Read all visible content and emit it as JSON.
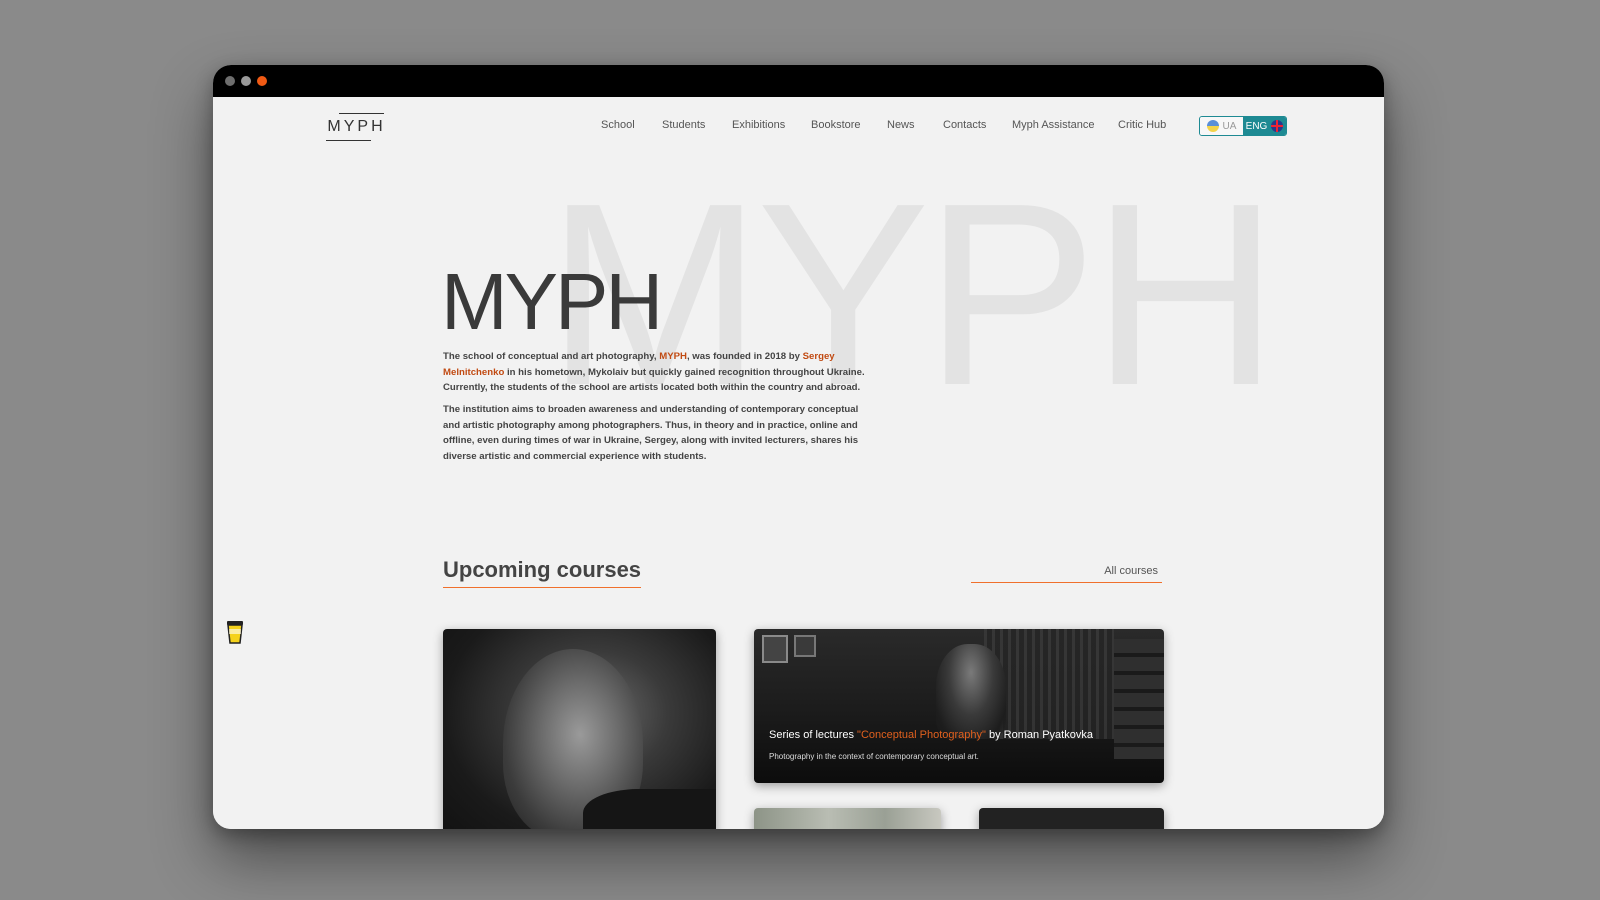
{
  "logo": {
    "text": "MYPH"
  },
  "nav": {
    "items": [
      {
        "label": "School"
      },
      {
        "label": "Students"
      },
      {
        "label": "Exhibitions"
      },
      {
        "label": "Bookstore"
      },
      {
        "label": "News"
      },
      {
        "label": "Contacts"
      },
      {
        "label": "Myph Assistance"
      },
      {
        "label": "Critic Hub"
      }
    ]
  },
  "lang": {
    "ua": "UA",
    "eng": "ENG",
    "active": "ENG",
    "accent": "#1e8a93"
  },
  "hero": {
    "bg_text": "MYPH",
    "title": "MYPH",
    "p1": {
      "t1": "The school of conceptual and art photography, ",
      "brand": "MYPH",
      "t2": ", was founded in 2018 by ",
      "founder": "Sergey Melnitchenko",
      "t3": " in his hometown, Mykolaiv but quickly gained recognition throughout Ukraine. Currently, the students of the school are artists located both within the country and abroad."
    },
    "p2": "The institution aims to broaden awareness and understanding of contemporary conceptual and artistic photography among photographers. Thus, in theory and in practice, online and offline, even during times of war in Ukraine, Sergey, along with invited lecturers, shares his diverse artistic and commercial experience with students."
  },
  "courses": {
    "heading": "Upcoming courses",
    "all_label": "All courses",
    "featured": {
      "prefix": "Series of lectures ",
      "course_name": "\"Conceptual Photography\"",
      "suffix": " by Roman Pyatkovka",
      "description": "Photography in the context of contemporary conceptual art."
    }
  },
  "colors": {
    "accent": "#f05a14",
    "link": "#c14a12",
    "background": "#f2f2f2"
  }
}
